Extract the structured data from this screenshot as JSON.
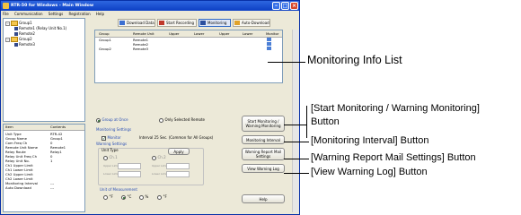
{
  "window": {
    "title": "RTR-50 for Windows - Main Window",
    "menu": [
      "File",
      "Communication",
      "Settings",
      "Registration",
      "Help"
    ]
  },
  "tree": {
    "groups": [
      {
        "label": "Group1",
        "children": [
          "Remote1 (Relay Unit No.1)",
          "Remote2"
        ]
      },
      {
        "label": "Group2",
        "children": [
          "Remote3"
        ]
      }
    ]
  },
  "properties": {
    "headers": [
      "Item",
      "Contents"
    ],
    "rows": [
      [
        "Unit Type",
        "RTR-42"
      ],
      [
        "Group Name",
        "Group1"
      ],
      [
        "Com Freq Ch",
        "0"
      ],
      [
        "Remote Unit Name",
        "Remote1"
      ],
      [
        "Relay Route",
        "Relay1"
      ],
      [
        "Relay Unit Freq Ch",
        "0"
      ],
      [
        "Relay Unit No.",
        "1"
      ],
      [
        "Ch1 Upper Limit",
        ""
      ],
      [
        "Ch1 Lower Limit",
        ""
      ],
      [
        "Ch2 Upper Limit",
        ""
      ],
      [
        "Ch2 Lower Limit",
        ""
      ],
      [
        "Monitoring Interval",
        "---"
      ],
      [
        "Auto Download",
        "---"
      ]
    ]
  },
  "toolbar": {
    "buttons": [
      "Download Data",
      "Start Recording",
      "Monitoring",
      "Auto-Download"
    ]
  },
  "grid": {
    "headers": [
      "Group",
      "Remote Unit",
      "Upper",
      "Lower",
      "Upper",
      "Lower",
      "Monitor"
    ],
    "rows": [
      [
        "Group1",
        "Remote1"
      ],
      [
        "",
        "Remote2"
      ],
      [
        "Group2",
        "Remote3"
      ]
    ]
  },
  "controls": {
    "mode_all": "Group at Once",
    "mode_selected": "Only Selected Remote",
    "monitoring_settings": "Monitoring Settings",
    "monitor_checkbox": "Monitor",
    "interval_text": "Interval 25 Sec. (Common for All Groups)",
    "warning_settings": "Warning Settings",
    "unit_type": "Unit Type",
    "apply": "Apply",
    "ch1": "Ch.1",
    "ch2": "Ch.2",
    "upper_limit": "Upper Limit",
    "lower_limit": "Lower Limit",
    "unit_measurement": "Unit of Measurement",
    "units": [
      "°F",
      "°C",
      "%",
      "°F"
    ],
    "start_btn": "Start Monitoring / Warning Monitoring",
    "interval_btn": "Monitoring Interval",
    "mail_btn": "Warning Report Mail Settings",
    "log_btn": "View Warning Log",
    "help_btn": "Help"
  },
  "callouts": {
    "info_list": "Monitoring Info List",
    "start_line1": "[Start Monitoring / Warning Monitoring]",
    "start_line2": "Button",
    "interval": "[Monitoring Interval] Button",
    "mail": "[Warning Report Mail Settings] Button",
    "log": "[View Warning Log] Button"
  }
}
